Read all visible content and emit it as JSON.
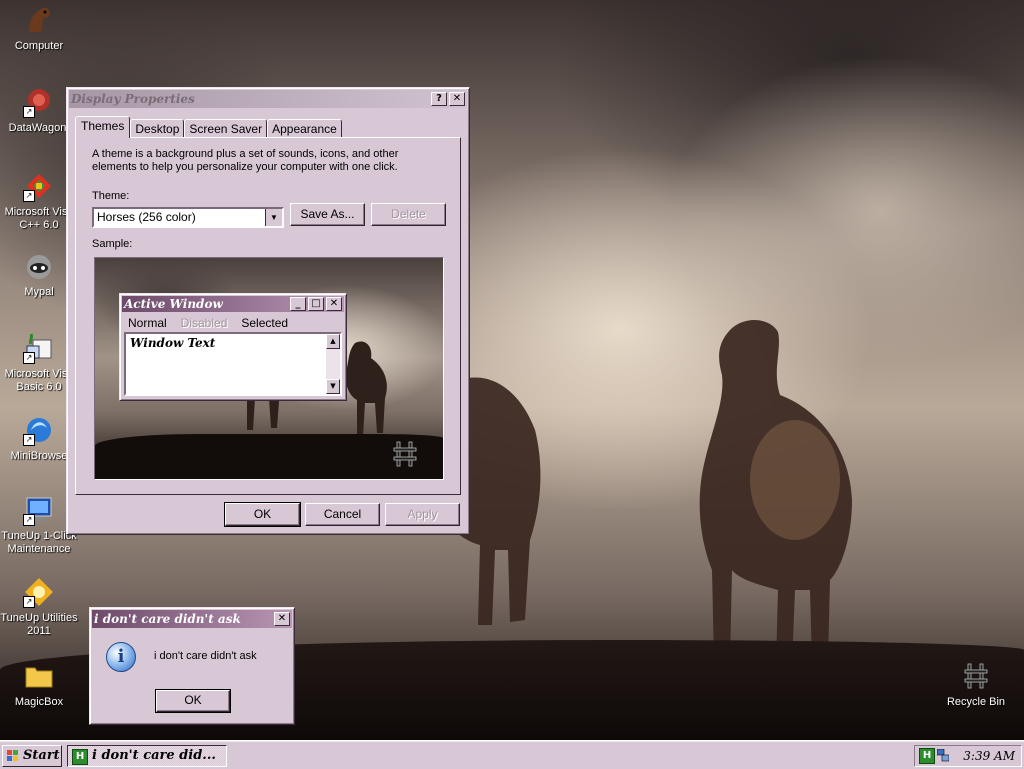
{
  "desktop": {
    "icons": [
      {
        "label": "Computer",
        "icon": "horse-computer-icon"
      },
      {
        "label": "DataWagon.",
        "icon": "datawagon-icon"
      },
      {
        "label": "Microsoft Visu C++ 6.0",
        "icon": "visual-cpp-icon"
      },
      {
        "label": "Mypal",
        "icon": "mypal-icon"
      },
      {
        "label": "Microsoft Visu Basic 6.0",
        "icon": "visual-basic-icon"
      },
      {
        "label": "MiniBrowse",
        "icon": "minibrowser-icon"
      },
      {
        "label": "TuneUp 1-Click Maintenance",
        "icon": "tuneup-maintenance-icon"
      },
      {
        "label": "TuneUp Utilities 2011",
        "icon": "tuneup-utilities-icon"
      },
      {
        "label": "MagicBox",
        "icon": "folder-icon"
      }
    ],
    "recycle_bin": {
      "label": "Recycle Bin",
      "icon": "recycle-bin-icon"
    }
  },
  "display_properties": {
    "title": "Display Properties",
    "help_glyph": "?",
    "close_glyph": "✕",
    "tabs": [
      "Themes",
      "Desktop",
      "Screen Saver",
      "Appearance"
    ],
    "selected_tab": "Themes",
    "description": "A theme is a background plus a set of sounds, icons, and other elements to help you personalize your computer with one click.",
    "theme_label": "Theme:",
    "theme_value": "Horses (256 color)",
    "save_as": "Save As...",
    "delete": "Delete",
    "sample_label": "Sample:",
    "sample": {
      "window_title": "Active Window",
      "menu": [
        "Normal",
        "Disabled",
        "Selected"
      ],
      "window_text": "Window Text"
    },
    "ok": "OK",
    "cancel": "Cancel",
    "apply": "Apply"
  },
  "message_box": {
    "title": "i don't care didn't ask",
    "text": "i don't care didn't ask",
    "ok": "OK",
    "close_glyph": "✕"
  },
  "taskbar": {
    "start": "Start",
    "task_button": "i don't care did...",
    "clock": "3:39 AM"
  },
  "colors": {
    "window_face": "#d8c8d6",
    "active_title": "#6e4a6a",
    "inactive_title": "#a898a6"
  }
}
